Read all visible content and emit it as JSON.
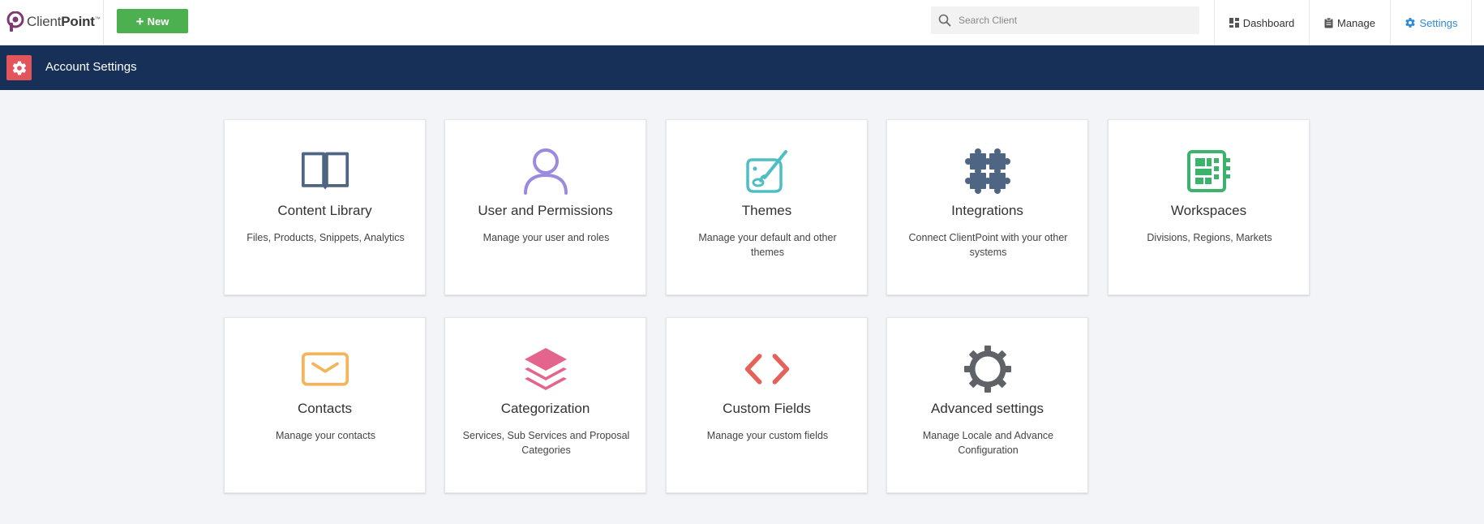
{
  "brand": {
    "name_light": "Client",
    "name_bold": "Point",
    "tm": "™"
  },
  "toolbar": {
    "new_label": "New"
  },
  "search": {
    "placeholder": "Search Client"
  },
  "nav": {
    "dashboard": "Dashboard",
    "manage": "Manage",
    "settings": "Settings"
  },
  "header": {
    "title": "Account Settings"
  },
  "cards": [
    {
      "title": "Content Library",
      "desc": "Files, Products, Snippets, Analytics",
      "icon": "book-icon",
      "color": "#4f6584"
    },
    {
      "title": "User and Permissions",
      "desc": "Manage your user and roles",
      "icon": "user-icon",
      "color": "#9b8ae0"
    },
    {
      "title": "Themes",
      "desc": "Manage your default and other themes",
      "icon": "palette-icon",
      "color": "#4dbfc4"
    },
    {
      "title": "Integrations",
      "desc": "Connect ClientPoint with your other systems",
      "icon": "puzzle-icon",
      "color": "#4f6584"
    },
    {
      "title": "Workspaces",
      "desc": "Divisions, Regions, Markets",
      "icon": "workspace-icon",
      "color": "#3cb36b"
    },
    {
      "title": "Contacts",
      "desc": "Manage your contacts",
      "icon": "envelope-icon",
      "color": "#f2b55c"
    },
    {
      "title": "Categorization",
      "desc": "Services, Sub Services and Proposal Categories",
      "icon": "layers-icon",
      "color": "#e3658d"
    },
    {
      "title": "Custom Fields",
      "desc": "Manage your custom fields",
      "icon": "code-icon",
      "color": "#e5625a"
    },
    {
      "title": "Advanced settings",
      "desc": "Manage Locale and Advance Configuration",
      "icon": "gear-icon",
      "color": "#5f6266"
    }
  ],
  "colors": {
    "header_bg": "#173058",
    "new_button": "#4caf50",
    "active_nav": "#2d8ad6",
    "header_icon_bg": "#e2555a"
  }
}
